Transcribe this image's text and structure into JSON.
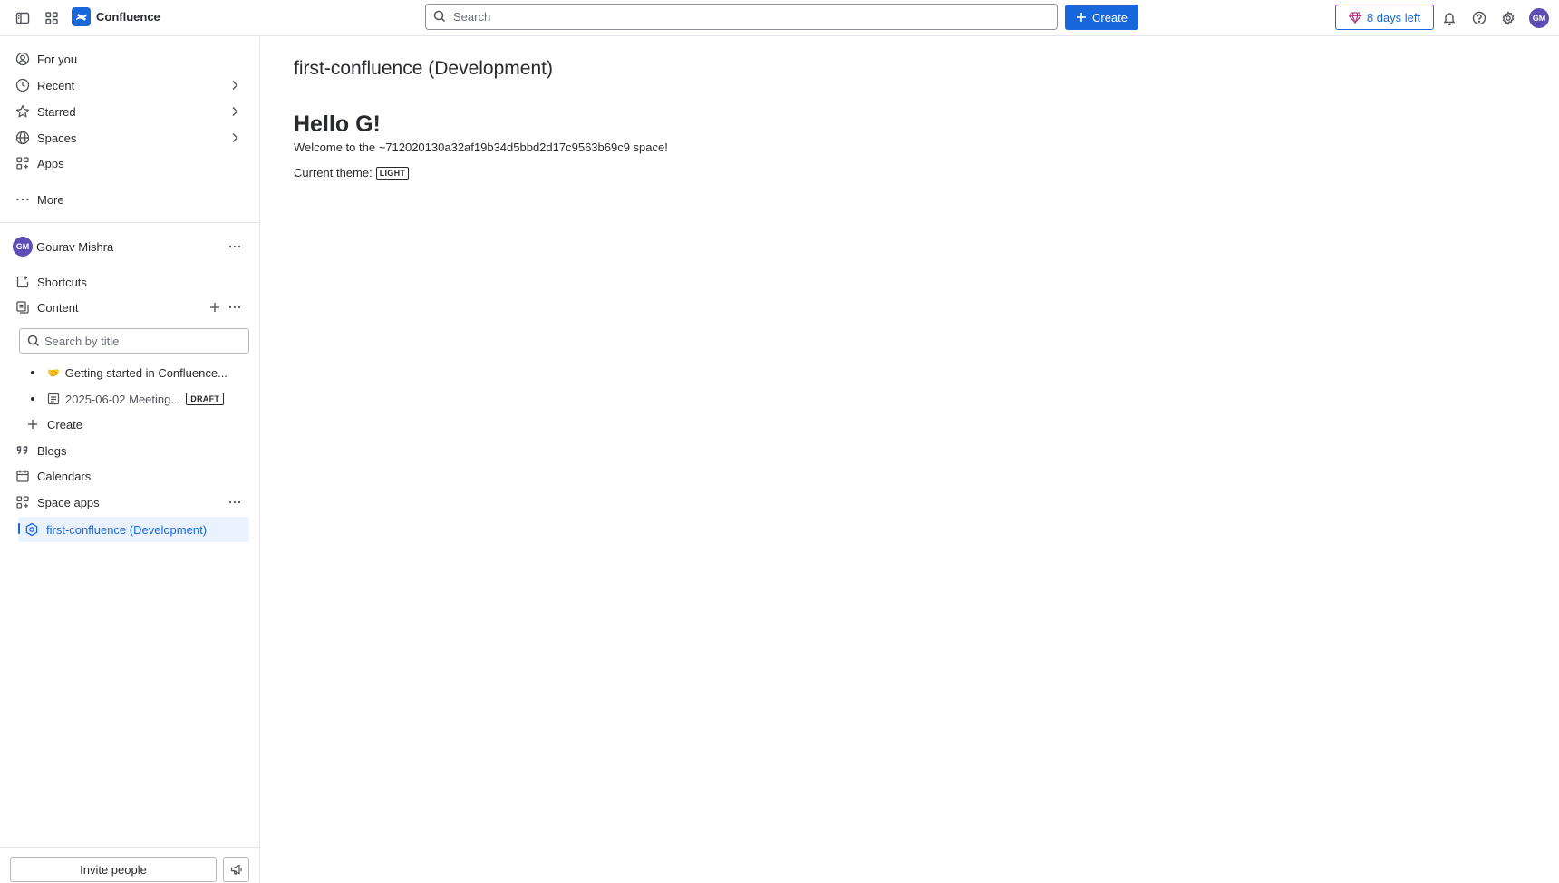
{
  "topbar": {
    "app_name": "Confluence",
    "search_placeholder": "Search",
    "create_label": "Create",
    "trial_label": "8 days left",
    "avatar_initials": "GM"
  },
  "sidebar": {
    "nav": [
      {
        "label": "For you",
        "icon": "person-circle-icon"
      },
      {
        "label": "Recent",
        "icon": "clock-icon"
      },
      {
        "label": "Starred",
        "icon": "star-icon"
      },
      {
        "label": "Spaces",
        "icon": "globe-icon"
      },
      {
        "label": "Apps",
        "icon": "apps-icon"
      },
      {
        "label": "More",
        "icon": "more-icon"
      }
    ],
    "user": {
      "name": "Gourav Mishra",
      "initials": "GM"
    },
    "shortcuts_label": "Shortcuts",
    "content_label": "Content",
    "search_placeholder": "Search by title",
    "tree": [
      {
        "label": "Getting started in Confluence...",
        "icon": "handshake-emoji"
      },
      {
        "label": "2025-06-02 Meeting...",
        "icon": "page-icon",
        "badge": "DRAFT"
      }
    ],
    "create_label": "Create",
    "blogs_label": "Blogs",
    "calendars_label": "Calendars",
    "space_apps_label": "Space apps",
    "selected_app_label": "first-confluence (Development)",
    "invite_label": "Invite people"
  },
  "main": {
    "page_title": "first-confluence (Development)",
    "heading": "Hello G!",
    "welcome_text": "Welcome to the ~712020130a32af19b34d5bbd2d17c9563b69c9 space!",
    "theme_label": "Current theme:",
    "theme_value": "LIGHT"
  },
  "colors": {
    "brand": "#1868db",
    "avatar": "#5e4db2",
    "selected_bg": "#e9f2fe"
  }
}
